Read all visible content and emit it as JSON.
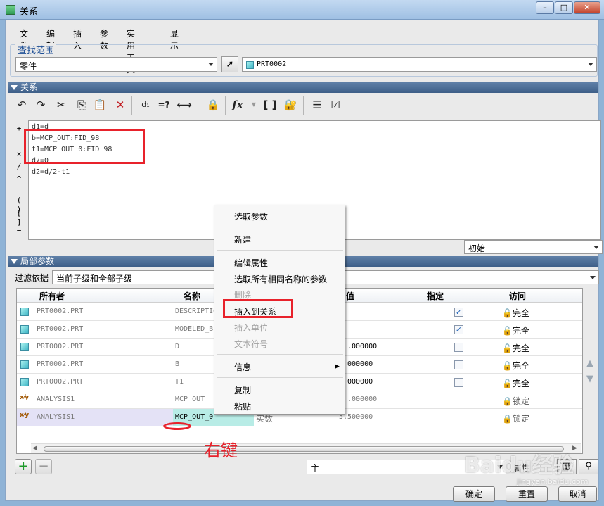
{
  "window": {
    "title": "关系",
    "min": "–",
    "max": "□",
    "close": "✕"
  },
  "menu": [
    "文件",
    "编辑",
    "插入",
    "参数",
    "实用工具",
    "显示"
  ],
  "lookup": {
    "section_label": "查找范围",
    "scope": "零件",
    "model": "PRT0002"
  },
  "relations": {
    "header": "关系",
    "lines": [
      "d1=d",
      "b=MCP_OUT:FID_98",
      "t1=MCP_OUT_0:FID_98",
      "d7=0",
      "d2=d/2-t1"
    ],
    "operators": [
      "+",
      "−",
      "×",
      "/",
      "^",
      "( )",
      "[ ]",
      "="
    ],
    "sort_option": "初始"
  },
  "local_params": {
    "header": "局部参数",
    "filter_label": "过滤依据",
    "filter_value": "当前子级和全部子级",
    "columns": [
      "所有者",
      "名称",
      "值",
      "指定",
      "访问"
    ],
    "rows": [
      {
        "owner": "PRT0002.PRT",
        "name": "DESCRIPTIO",
        "value": "",
        "designate": true,
        "access": "完全",
        "icon": "part-icon"
      },
      {
        "owner": "PRT0002.PRT",
        "name": "MODELED_B",
        "value": "",
        "designate": true,
        "access": "完全",
        "icon": "part-icon"
      },
      {
        "owner": "PRT0002.PRT",
        "name": "D",
        "value": ".000000",
        "designate": false,
        "access": "完全",
        "icon": "part-icon"
      },
      {
        "owner": "PRT0002.PRT",
        "name": "B",
        "value": "000000",
        "designate": false,
        "access": "完全",
        "icon": "part-icon"
      },
      {
        "owner": "PRT0002.PRT",
        "name": "T1",
        "value": "000000",
        "designate": false,
        "access": "完全",
        "icon": "part-icon"
      },
      {
        "owner": "ANALYSIS1",
        "name": "MCP_OUT",
        "value": ".000000",
        "designate": null,
        "access": "锁定",
        "icon": "analysis-icon"
      },
      {
        "owner": "ANALYSIS1",
        "name": "MCP_OUT_0",
        "value": "5.500000",
        "type": "实数",
        "designate": null,
        "access": "锁定",
        "icon": "analysis-icon"
      }
    ],
    "main_field": "主",
    "props_label": "属性"
  },
  "context_menu": {
    "items": [
      {
        "label": "选取参数",
        "enabled": true
      },
      {
        "label": "新建",
        "enabled": true
      },
      {
        "label": "编辑属性",
        "enabled": true
      },
      {
        "label": "选取所有相同名称的参数",
        "enabled": true
      },
      {
        "label": "删除",
        "enabled": false
      },
      {
        "label": "插入到关系",
        "enabled": true
      },
      {
        "label": "插入单位",
        "enabled": false
      },
      {
        "label": "文本符号",
        "enabled": false
      },
      {
        "label": "信息",
        "enabled": true
      },
      {
        "label": "复制",
        "enabled": true
      },
      {
        "label": "粘贴",
        "enabled": true
      }
    ]
  },
  "annotation": {
    "text": "右键",
    "color": "#e8222b"
  },
  "buttons": {
    "ok": "确定",
    "reset": "重置",
    "cancel": "取消"
  },
  "watermark": {
    "text": "Baidu经验",
    "url": "jingyan.baidu.com"
  }
}
